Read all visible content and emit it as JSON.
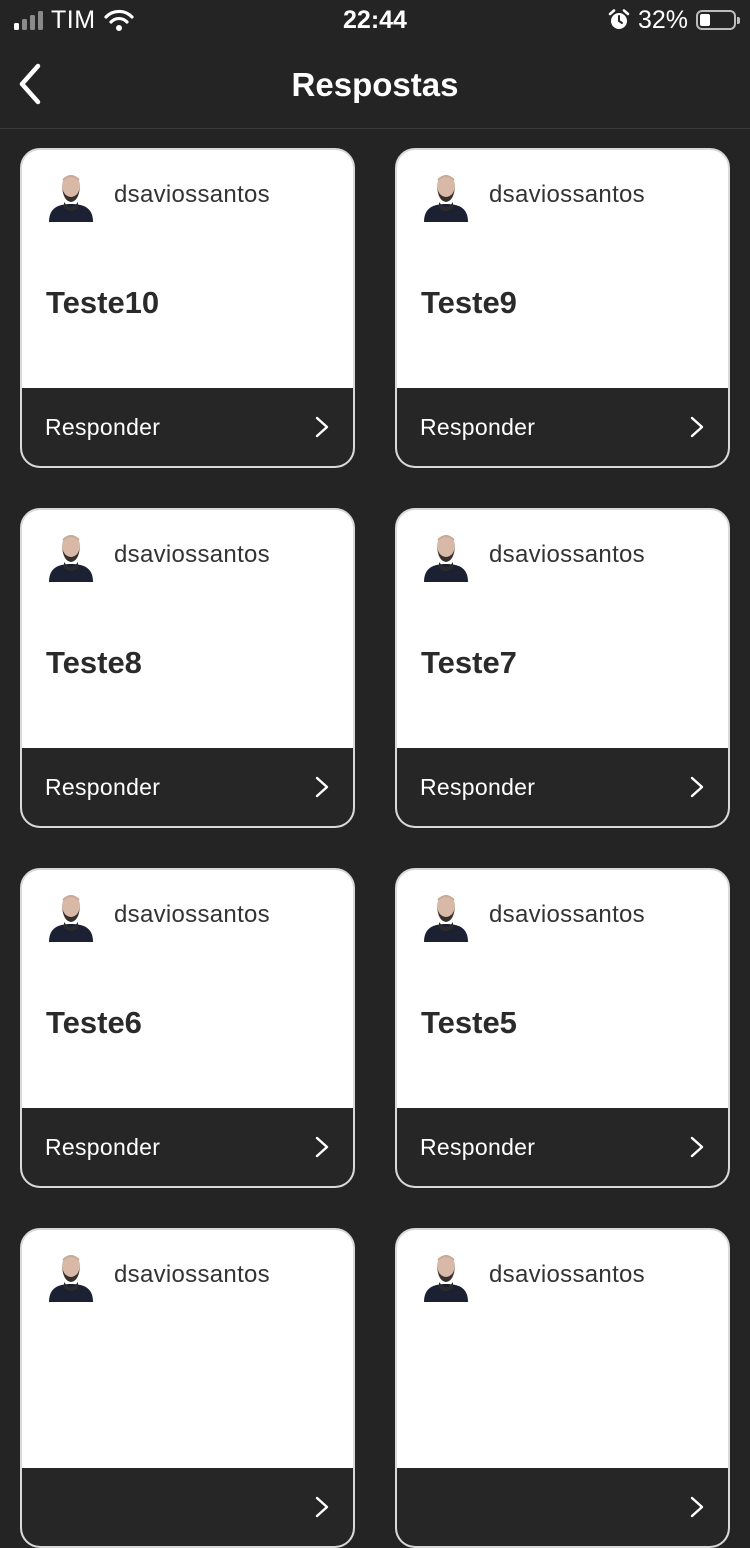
{
  "status_bar": {
    "carrier": "TIM",
    "time": "22:44",
    "battery_percent": "32%",
    "battery_level": 0.32,
    "signal_bars_active": 1,
    "icons": [
      "signal-icon",
      "wifi-icon",
      "alarm-icon",
      "battery-icon"
    ]
  },
  "nav": {
    "title": "Respostas",
    "back_icon": "chevron-left-icon"
  },
  "cards": [
    {
      "username": "dsaviossantos",
      "title": "Teste10",
      "action": "Responder"
    },
    {
      "username": "dsaviossantos",
      "title": "Teste9",
      "action": "Responder"
    },
    {
      "username": "dsaviossantos",
      "title": "Teste8",
      "action": "Responder"
    },
    {
      "username": "dsaviossantos",
      "title": "Teste7",
      "action": "Responder"
    },
    {
      "username": "dsaviossantos",
      "title": "Teste6",
      "action": "Responder"
    },
    {
      "username": "dsaviossantos",
      "title": "Teste5",
      "action": "Responder"
    },
    {
      "username": "dsaviossantos",
      "title": "",
      "action": ""
    },
    {
      "username": "dsaviossantos",
      "title": "",
      "action": ""
    }
  ],
  "colors": {
    "background": "#242424",
    "card": "#ffffff",
    "card_footer": "#262626",
    "text_dark": "#2a2a2a"
  }
}
